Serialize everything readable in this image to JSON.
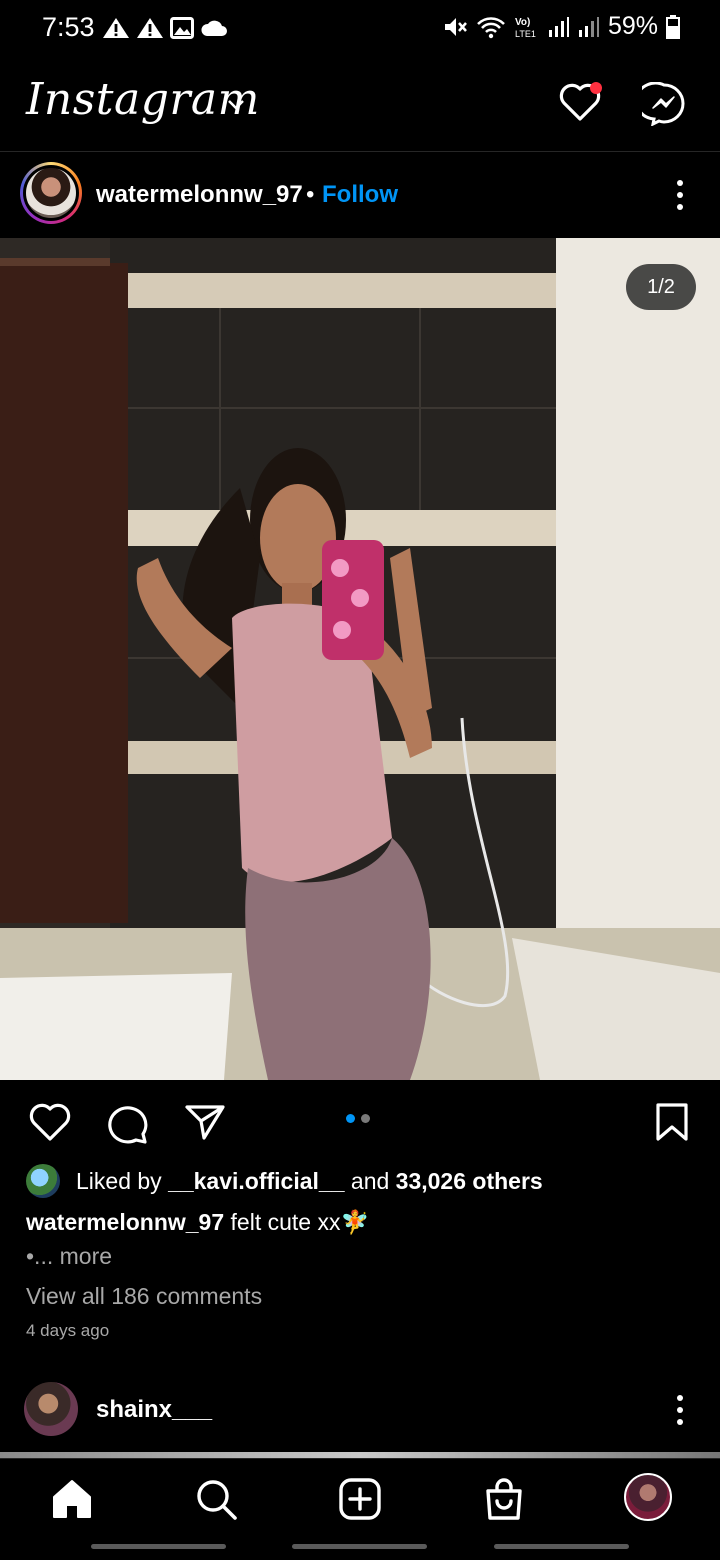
{
  "status_bar": {
    "time": "7:53",
    "left_icons": [
      "warning-icon",
      "warning-icon",
      "image-icon",
      "cloud-icon"
    ],
    "right_icons": [
      "mute-icon",
      "wifi-icon",
      "volte-icon",
      "signal-icon",
      "signal-icon"
    ],
    "battery": "59%"
  },
  "header": {
    "logo": "Instagram",
    "icons": [
      "chevron-down-icon",
      "heart-icon",
      "messenger-icon"
    ],
    "accent": "#ff3040"
  },
  "post": {
    "username": "watermelonnw_97",
    "separator": "•",
    "follow": "Follow",
    "follow_color": "#0095f6",
    "counter": "1/2",
    "carousel_dots": 2,
    "carousel_active": 1,
    "liked_by_prefix": "Liked by ",
    "liked_by_user": "__kavi.official__",
    "liked_by_and": " and ",
    "liked_by_others": "33,026 others",
    "caption_user": "watermelonnw_97",
    "caption_text": " felt cute xx🧚",
    "more": "•... more",
    "view_comments": "View all 186 comments",
    "time_ago": "4 days ago"
  },
  "next_post": {
    "username": "shainx___"
  },
  "nav": {
    "items": [
      "home-icon",
      "search-icon",
      "create-icon",
      "shop-icon",
      "profile-avatar"
    ]
  }
}
